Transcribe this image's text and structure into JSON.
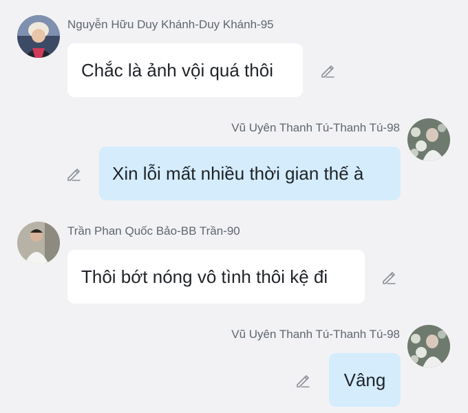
{
  "messages": [
    {
      "sender": "Nguyễn Hữu Duy Khánh-Duy Khánh-95",
      "text": "Chắc là ảnh vội quá thôi",
      "side": "incoming",
      "avatar_icon": "user-avatar"
    },
    {
      "sender": "Vũ Uyên Thanh Tú-Thanh Tú-98",
      "text": "Xin lỗi mất nhiều thời gian thế à",
      "side": "outgoing",
      "avatar_icon": "user-avatar"
    },
    {
      "sender": "Trần Phan Quốc Bảo-BB Trần-90",
      "text": "Thôi bớt nóng vô tình thôi kệ đi",
      "side": "incoming",
      "avatar_icon": "user-avatar"
    },
    {
      "sender": "Vũ Uyên Thanh Tú-Thanh Tú-98",
      "text": "Vâng",
      "side": "outgoing",
      "avatar_icon": "user-avatar"
    }
  ],
  "icons": {
    "edit": "pencil-icon"
  },
  "colors": {
    "background": "#f2f2f4",
    "incoming_bubble": "#ffffff",
    "outgoing_bubble": "#d4ecfc",
    "sender_text": "#5f6670",
    "message_text": "#1f2328"
  }
}
